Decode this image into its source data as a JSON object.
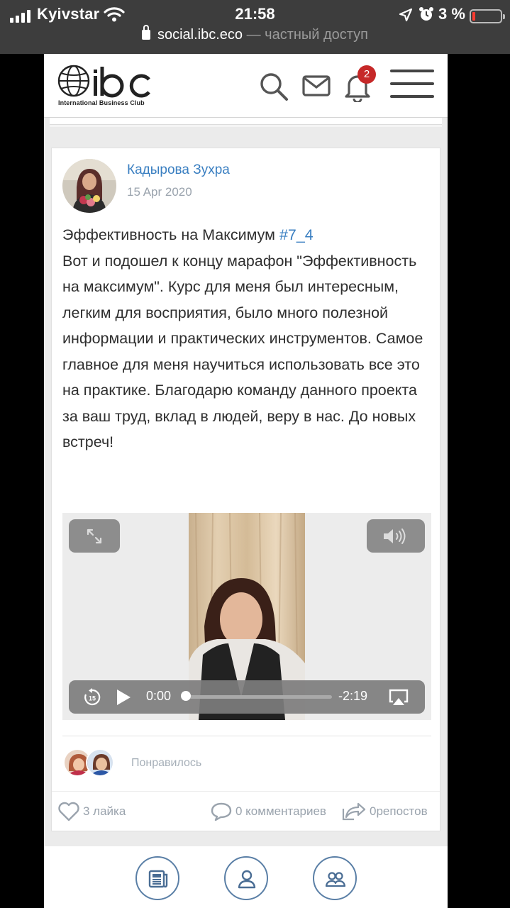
{
  "status_bar": {
    "carrier": "Kyivstar",
    "time": "21:58",
    "battery_percent": "3 %",
    "battery_level": 0.03,
    "url_host": "social.ibc.eco",
    "url_suffix": " — частный доступ"
  },
  "header": {
    "logo_subtitle": "International Business Club",
    "notification_count": "2"
  },
  "post": {
    "author": "Кадырова Зухра",
    "date": "15 Apr 2020",
    "title": "Эффективность на Максимум ",
    "hashtag": "#7_4",
    "body": "Вот и подошел к концу марафон \"Эффективность на максимум\". Курс для меня был интересным, легким для восприятия, было много полезной информации и практических инструментов. Самое главное для меня научиться использовать все это на практике. Благодарю команду данного проекта за ваш труд, вклад в людей, веру в нас. До новых встреч!",
    "video": {
      "current_time": "0:00",
      "remaining_time": "-2:19",
      "progress": 0
    },
    "liked_label": "Понравилось",
    "likes": "3 лайка",
    "comments": "0 комментариев",
    "reposts": "0репостов"
  },
  "icons": {
    "accent": "#3a7fc1",
    "badge": "#c62828",
    "nav_ring": "#5a7fa6"
  }
}
